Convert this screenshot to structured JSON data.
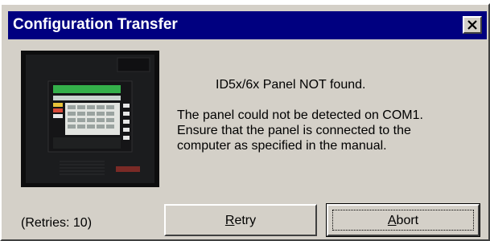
{
  "dialog": {
    "title": "Configuration Transfer",
    "close_icon": "close-icon"
  },
  "image": {
    "description_icon": "fire-panel-image"
  },
  "message": {
    "heading": "ID5x/6x Panel NOT found.",
    "lines": [
      "The panel could not be detected on COM1.",
      "Ensure that the panel is connected to the",
      "computer as specified in the manual."
    ]
  },
  "status": {
    "retries": "(Retries: 10)"
  },
  "buttons": {
    "retry": {
      "mnemonic": "R",
      "rest": "etry"
    },
    "abort": {
      "mnemonic": "A",
      "rest": "bort"
    }
  },
  "colors": {
    "titlebar": "#000080",
    "face": "#d4d0c8"
  }
}
